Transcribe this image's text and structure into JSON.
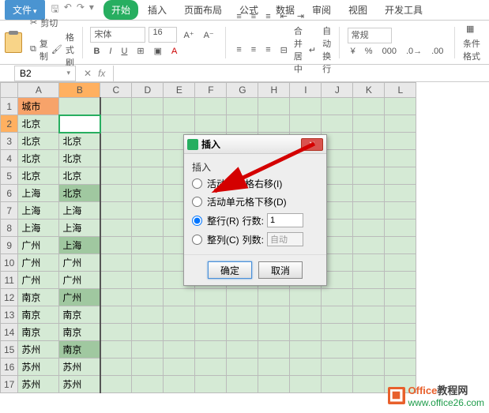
{
  "menu": {
    "file": "文件"
  },
  "tabs": [
    "开始",
    "插入",
    "页面布局",
    "公式",
    "数据",
    "审阅",
    "视图",
    "开发工具"
  ],
  "active_tab": 0,
  "ribbon": {
    "cut": "剪切",
    "copy": "复制",
    "fmt": "格式刷",
    "font_name": "宋体",
    "font_size": "16",
    "merge": "合并居中",
    "wrap": "自动换行",
    "numfmt": "常规",
    "cond": "条件格式"
  },
  "namebox": "B2",
  "columns": [
    "A",
    "B",
    "C",
    "D",
    "E",
    "F",
    "G",
    "H",
    "I",
    "J",
    "K",
    "L"
  ],
  "rows": [
    {
      "n": 1,
      "a": "城市",
      "b": ""
    },
    {
      "n": 2,
      "a": "北京",
      "b": ""
    },
    {
      "n": 3,
      "a": "北京",
      "b": "北京"
    },
    {
      "n": 4,
      "a": "北京",
      "b": "北京"
    },
    {
      "n": 5,
      "a": "北京",
      "b": "北京"
    },
    {
      "n": 6,
      "a": "上海",
      "b": "北京"
    },
    {
      "n": 7,
      "a": "上海",
      "b": "上海"
    },
    {
      "n": 8,
      "a": "上海",
      "b": "上海"
    },
    {
      "n": 9,
      "a": "广州",
      "b": "上海"
    },
    {
      "n": 10,
      "a": "广州",
      "b": "广州"
    },
    {
      "n": 11,
      "a": "广州",
      "b": "广州"
    },
    {
      "n": 12,
      "a": "南京",
      "b": "广州"
    },
    {
      "n": 13,
      "a": "南京",
      "b": "南京"
    },
    {
      "n": 14,
      "a": "南京",
      "b": "南京"
    },
    {
      "n": 15,
      "a": "苏州",
      "b": "南京"
    },
    {
      "n": 16,
      "a": "苏州",
      "b": "苏州"
    },
    {
      "n": 17,
      "a": "苏州",
      "b": "苏州"
    }
  ],
  "highlight_b": [
    6,
    9,
    12,
    15
  ],
  "dialog": {
    "title": "插入",
    "group": "插入",
    "opt_shift_right": "活动单元格右移(I)",
    "opt_shift_down": "活动单元格下移(D)",
    "opt_row": "整行(R)",
    "opt_col": "整列(C)",
    "rows_lbl": "行数:",
    "cols_lbl": "列数:",
    "rows_val": "1",
    "cols_val": "自动",
    "selected": "row",
    "ok": "确定",
    "cancel": "取消"
  },
  "watermark": {
    "brand1": "Office",
    "brand2": "教程网",
    "url": "www.office26.com"
  }
}
